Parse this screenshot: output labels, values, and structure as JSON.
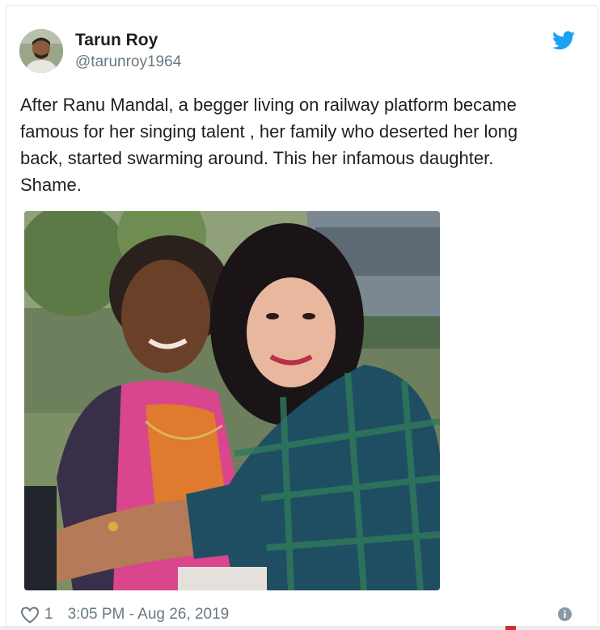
{
  "tweet": {
    "author": {
      "name": "Tarun Roy",
      "handle": "@tarunroy1964",
      "avatar_icon": "user-avatar-photo"
    },
    "brand_icon": "twitter-bird-icon",
    "brand_color": "#1da1f2",
    "text_lines": [
      "After Ranu Mandal, a begger living on railway platform became",
      "famous for her singing talent , her family who deserted her long",
      "back, started swarming around. This her infamous daughter.",
      "Shame."
    ],
    "image": {
      "icon": "photo-two-women-hugging"
    },
    "footer": {
      "like_icon": "heart-outline-icon",
      "like_count": "1",
      "timestamp": "3:05 PM - Aug 26, 2019",
      "info_icon": "info-circle-icon"
    }
  },
  "colors": {
    "text_primary": "#1c2022",
    "text_secondary": "#697882",
    "border": "#e1e8ed"
  }
}
